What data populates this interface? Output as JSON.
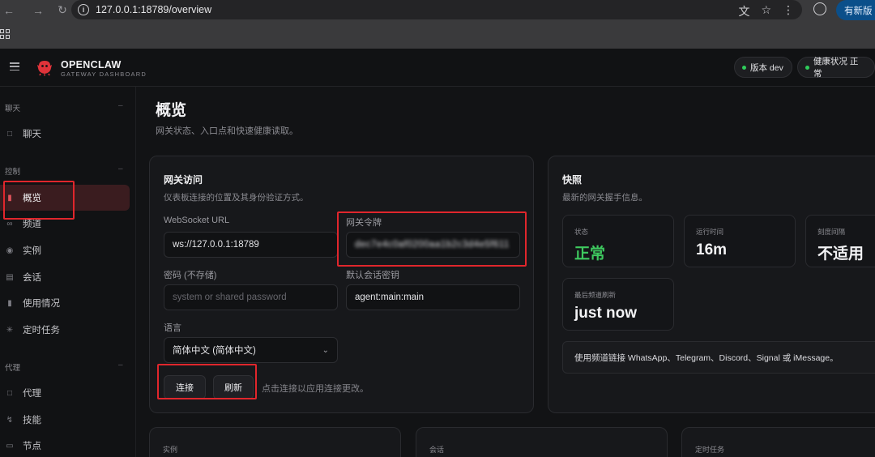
{
  "browser": {
    "url": "127.0.0.1:18789/overview",
    "update_label": "有新版"
  },
  "header": {
    "brand": "OPENCLAW",
    "brand_sub": "GATEWAY DASHBOARD",
    "version_label": "版本 dev",
    "health_label": "健康状况 正常"
  },
  "sidebar": {
    "sections": [
      {
        "title": "聊天",
        "items": [
          {
            "label": "聊天",
            "icon": "chat-icon"
          }
        ]
      },
      {
        "title": "控制",
        "items": [
          {
            "label": "概览",
            "icon": "bar-chart-icon",
            "active": true
          },
          {
            "label": "频道",
            "icon": "link-icon"
          },
          {
            "label": "实例",
            "icon": "broadcast-icon"
          },
          {
            "label": "会话",
            "icon": "document-icon"
          },
          {
            "label": "使用情况",
            "icon": "bar-chart-icon"
          },
          {
            "label": "定时任务",
            "icon": "loader-icon"
          }
        ]
      },
      {
        "title": "代理",
        "items": [
          {
            "label": "代理",
            "icon": "folder-icon"
          },
          {
            "label": "技能",
            "icon": "zap-icon"
          },
          {
            "label": "节点",
            "icon": "monitor-icon"
          }
        ]
      }
    ]
  },
  "page": {
    "title": "概览",
    "subtitle": "网关状态、入口点和快速健康读取。"
  },
  "gateway_access": {
    "title": "网关访问",
    "subtitle": "仪表板连接的位置及其身份验证方式。",
    "ws_label": "WebSocket URL",
    "ws_value": "ws://127.0.0.1:18789",
    "token_label": "网关令牌",
    "token_value": "dec7e4c0af0200aa1b2c3d4e5f611",
    "password_label": "密码 (不存储)",
    "password_placeholder": "system or shared password",
    "session_label": "默认会话密钥",
    "session_value": "agent:main:main",
    "language_label": "语言",
    "language_value": "简体中文 (简体中文)",
    "connect_label": "连接",
    "refresh_label": "刷新",
    "hint": "点击连接以应用连接更改。"
  },
  "snapshot": {
    "title": "快照",
    "subtitle": "最新的网关握手信息。",
    "stats": [
      {
        "label": "状态",
        "value": "正常"
      },
      {
        "label": "运行时间",
        "value": "16m"
      },
      {
        "label": "刻度间隔",
        "value": "不适用"
      },
      {
        "label": "最后频道刷新",
        "value": "just now"
      }
    ],
    "note": "使用频道链接 WhatsApp、Telegram、Discord、Signal 或 iMessage。"
  },
  "bottom_cards": [
    {
      "label": "实例"
    },
    {
      "label": "会话"
    },
    {
      "label": "定时任务"
    }
  ],
  "colors": {
    "accent_red": "#e0262c",
    "status_green": "#3ec95f",
    "update_blue": "#0b4f8a"
  }
}
